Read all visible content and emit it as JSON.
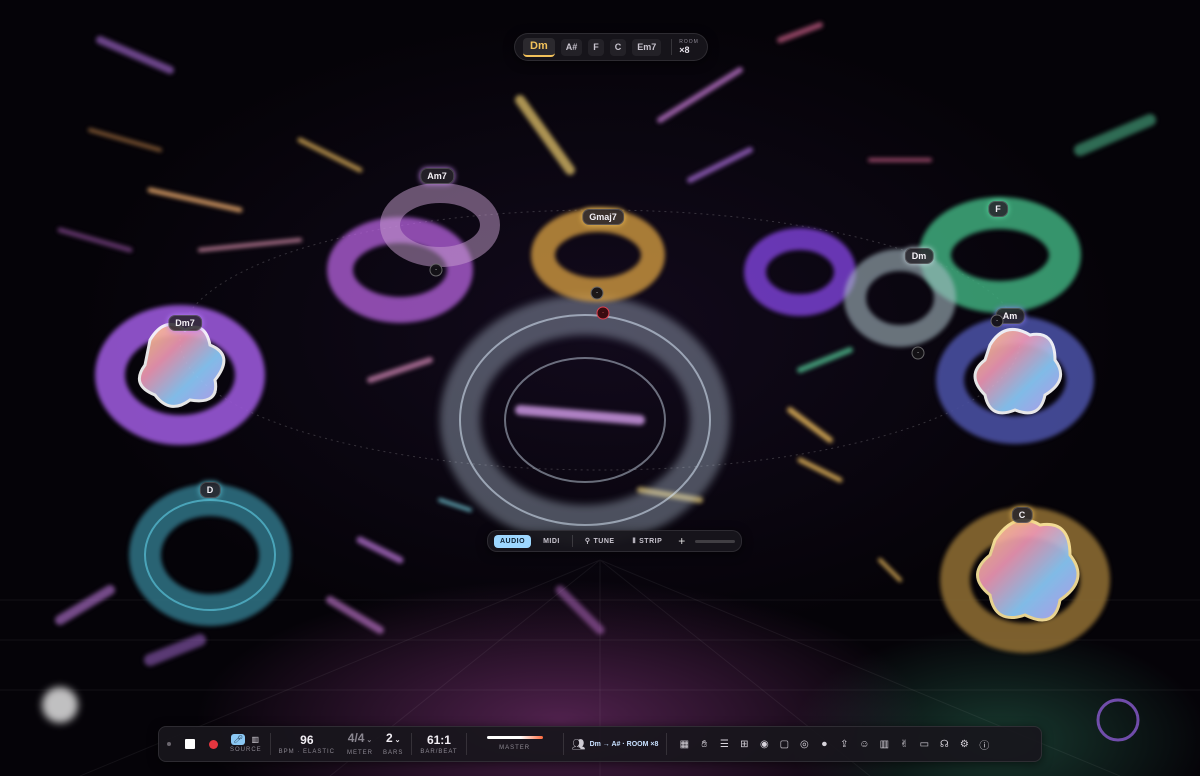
{
  "chord_strip": {
    "chords": [
      {
        "label": "Dm",
        "active": true
      },
      {
        "label": "A#",
        "active": false
      },
      {
        "label": "F",
        "active": false
      },
      {
        "label": "C",
        "active": false
      },
      {
        "label": "Em7",
        "active": false
      }
    ],
    "room_label": "ROOM",
    "room_value": "×8"
  },
  "scene": {
    "chord_labels": [
      {
        "text": "Am7",
        "color": "#c98af2"
      },
      {
        "text": "Gmaj7",
        "color": "#f2c15a"
      },
      {
        "text": "Dm7",
        "color": "#b884ff"
      },
      {
        "text": "F",
        "color": "#5ad6a0"
      },
      {
        "text": "Dm",
        "color": "#c8d8e0"
      },
      {
        "text": "Am",
        "color": "#8a7cf2"
      },
      {
        "text": "D",
        "color": "#5ec4d8"
      },
      {
        "text": "C",
        "color": "#f2c15a"
      }
    ]
  },
  "mode_bar": {
    "audio": "AUDIO",
    "midi": "MIDI",
    "tune": "TUNE",
    "strip": "STRIP",
    "add": "+"
  },
  "transport": {
    "source_label": "SOURCE",
    "bpm_value": "96",
    "bpm_label": "BPM · ELASTIC",
    "meter_value": "4/4",
    "meter_label": "METER",
    "bars_value": "2",
    "bars_label": "BARS",
    "position_value": "61:1",
    "position_label": "BAR/BEAT",
    "master_label": "MASTER",
    "route_text": "Dm → A# · ROOM ×8"
  },
  "colors": {
    "accent_gold": "#f2c15a",
    "accent_blue": "#9dd7ff",
    "record_red": "#e5363f"
  }
}
